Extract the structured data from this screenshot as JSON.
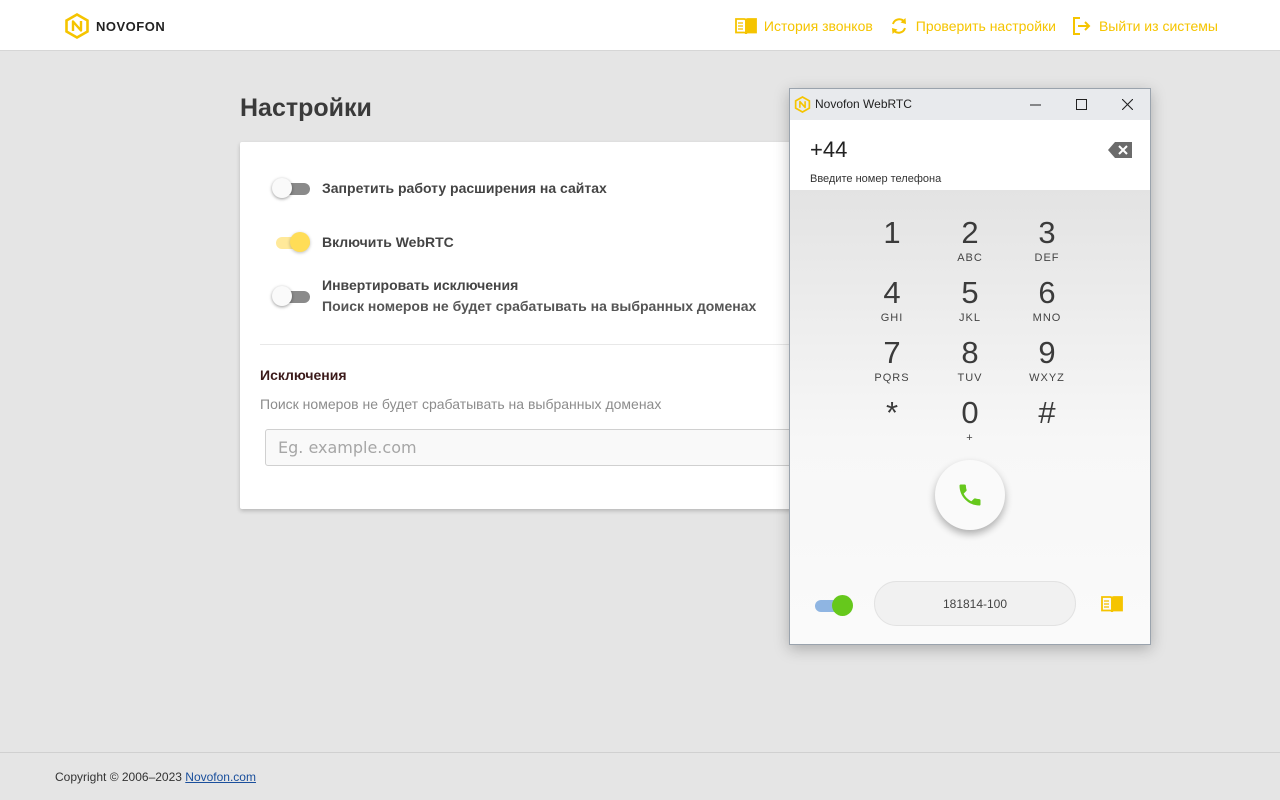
{
  "brand": {
    "name": "NOVOFON",
    "accent": "#f5c400"
  },
  "header": {
    "nav": [
      {
        "label": "История звонков",
        "icon": "book-icon"
      },
      {
        "label": "Проверить настройки",
        "icon": "refresh-icon"
      },
      {
        "label": "Выйти из системы",
        "icon": "logout-icon"
      }
    ]
  },
  "settings": {
    "title": "Настройки",
    "toggles": [
      {
        "label": "Запретить работу расширения на сайтах",
        "on": false
      },
      {
        "label": "Включить WebRTC",
        "on": true
      },
      {
        "label": "Инвертировать исключения",
        "sublabel": "Поиск номеров не будет срабатывать на выбранных доменах",
        "on": false
      }
    ],
    "exceptions": {
      "title": "Исключения",
      "description": "Поиск номеров не будет срабатывать на выбранных доменах",
      "input_value": "",
      "placeholder": "Eg. example.com"
    }
  },
  "webrtc": {
    "window_title": "Novofon WebRTC",
    "number": "+44",
    "number_hint": "Введите номер телефона",
    "keypad": [
      {
        "digit": "1",
        "letters": ""
      },
      {
        "digit": "2",
        "letters": "ABC"
      },
      {
        "digit": "3",
        "letters": "DEF"
      },
      {
        "digit": "4",
        "letters": "GHI"
      },
      {
        "digit": "5",
        "letters": "JKL"
      },
      {
        "digit": "6",
        "letters": "MNO"
      },
      {
        "digit": "7",
        "letters": "PQRS"
      },
      {
        "digit": "8",
        "letters": "TUV"
      },
      {
        "digit": "9",
        "letters": "WXYZ"
      },
      {
        "digit": "*",
        "letters": ""
      },
      {
        "digit": "0",
        "letters": "+"
      },
      {
        "digit": "#",
        "letters": ""
      }
    ],
    "line_label": "181814-100",
    "colors": {
      "call": "#66c81c",
      "toggle_track": "#8fb5e2"
    }
  },
  "footer": {
    "copyright": "Copyright © 2006–2023",
    "link": "Novofon.com"
  }
}
